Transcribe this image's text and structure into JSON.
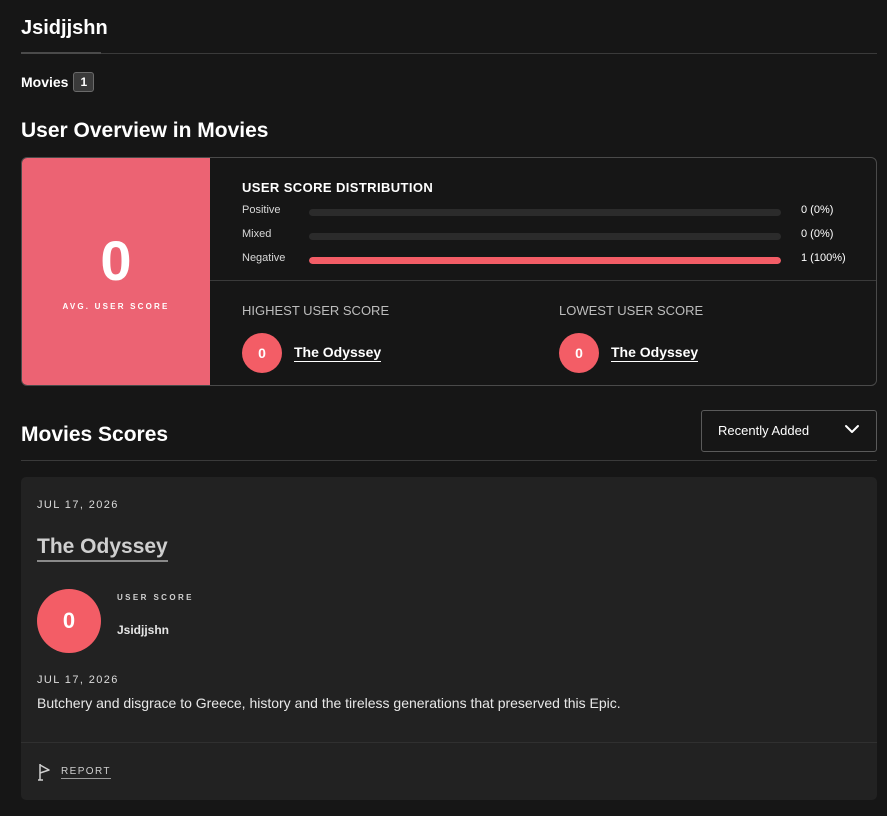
{
  "profile": {
    "username": "Jsidjjshn"
  },
  "tabs": [
    {
      "label": "Movies",
      "count": "1"
    }
  ],
  "overview": {
    "title": "User Overview in Movies",
    "avg_score": "0",
    "avg_label": "AVG. USER SCORE",
    "distribution": {
      "title": "USER SCORE DISTRIBUTION",
      "rows": [
        {
          "label": "Positive",
          "count": "0 (0%)",
          "fraction": 0
        },
        {
          "label": "Mixed",
          "count": "0 (0%)",
          "fraction": 0
        },
        {
          "label": "Negative",
          "count": "1 (100%)",
          "fraction": 1
        }
      ]
    },
    "highest": {
      "label": "HIGHEST USER SCORE",
      "score": "0",
      "title": "The Odyssey"
    },
    "lowest": {
      "label": "LOWEST USER SCORE",
      "score": "0",
      "title": "The Odyssey"
    }
  },
  "scores": {
    "title": "Movies Scores",
    "sort": {
      "selected": "Recently Added",
      "icon": "chevron-down-icon"
    },
    "reviews": [
      {
        "date": "JUL 17, 2026",
        "title": "The Odyssey",
        "score": "0",
        "score_label": "USER SCORE",
        "reviewer": "Jsidjjshn",
        "review_date": "JUL 17, 2026",
        "text": "Butchery and disgrace to Greece, history and the tireless generations that preserved this Epic.",
        "report_label": "REPORT",
        "report_icon": "flag-icon"
      }
    ]
  },
  "colors": {
    "background": "#161616",
    "card": "#222222",
    "negative": "#f35d66",
    "avg_box": "#ec6373"
  }
}
